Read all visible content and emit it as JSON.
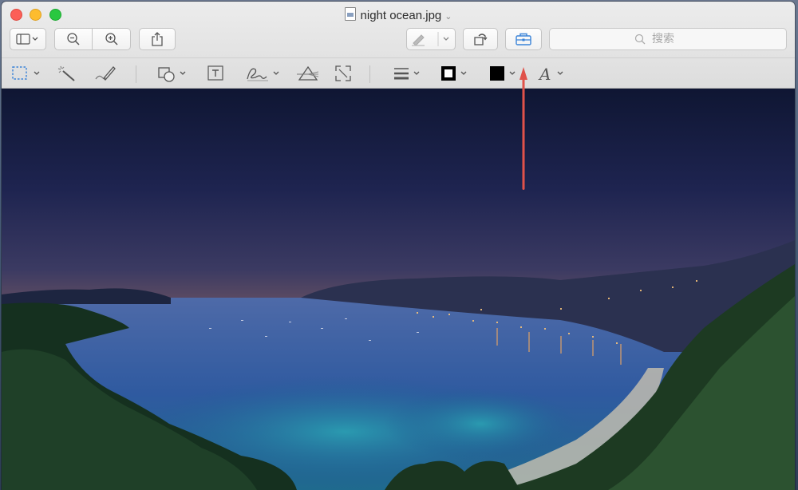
{
  "window": {
    "title": "night ocean.jpg"
  },
  "toolbar": {
    "buttons": [
      {
        "name": "sidebar-view-button",
        "icon": "sidebar-icon"
      },
      {
        "name": "zoom-out-button",
        "icon": "zoom-out-icon"
      },
      {
        "name": "zoom-in-button",
        "icon": "zoom-in-icon"
      },
      {
        "name": "share-button",
        "icon": "share-icon"
      },
      {
        "name": "highlight-button",
        "icon": "pen-icon"
      },
      {
        "name": "rotate-button",
        "icon": "rotate-icon"
      },
      {
        "name": "markup-toolbox-button",
        "icon": "toolbox-icon"
      }
    ],
    "search_placeholder": "搜索"
  },
  "markup_toolbar": {
    "tools": [
      "selection-tool",
      "instant-alpha-tool",
      "sketch-tool",
      "shapes-tool",
      "text-tool",
      "sign-tool",
      "adjust-color-tool",
      "adjust-size-tool",
      "line-style-tool",
      "border-color-tool",
      "fill-color-tool",
      "text-style-tool"
    ]
  },
  "colors": {
    "accent": "#3a83d8",
    "annotation_arrow": "#e0524a"
  }
}
